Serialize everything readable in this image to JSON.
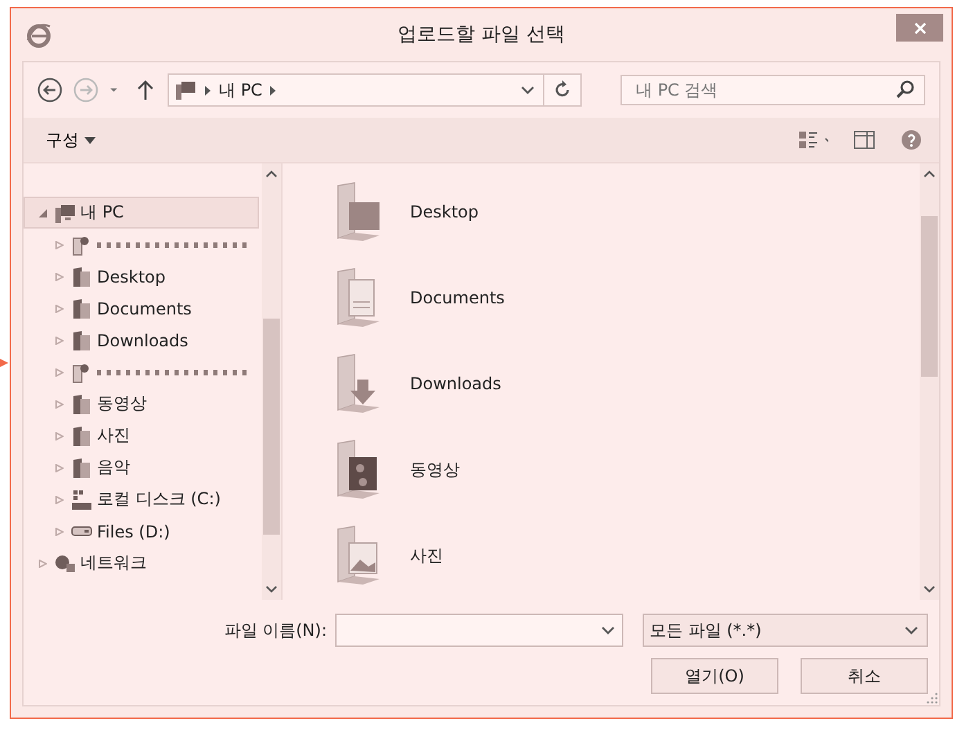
{
  "window": {
    "title": "업로드할 파일 선택"
  },
  "address_bar": {
    "path": [
      "내 PC"
    ]
  },
  "search": {
    "placeholder": "내 PC 검색"
  },
  "toolbar": {
    "organize": "구성"
  },
  "tree": [
    {
      "label": "내 PC",
      "kind": "pc",
      "selected": true,
      "expanded": true,
      "children": [
        {
          "kind": "redacted-user",
          "selected": false
        },
        {
          "label": "Desktop",
          "kind": "desktop",
          "selected": false
        },
        {
          "label": "Documents",
          "kind": "documents",
          "selected": false
        },
        {
          "label": "Downloads",
          "kind": "downloads",
          "selected": false
        },
        {
          "kind": "redacted-user",
          "selected": false
        },
        {
          "label": "동영상",
          "kind": "videos",
          "selected": false
        },
        {
          "label": "사진",
          "kind": "pictures",
          "selected": false
        },
        {
          "label": "음악",
          "kind": "music",
          "selected": false
        },
        {
          "label": "로컬 디스크 (C:)",
          "kind": "disk",
          "selected": false
        },
        {
          "label": "Files (D:)",
          "kind": "drive",
          "selected": false
        }
      ]
    },
    {
      "label": "네트워크",
      "kind": "network",
      "selected": false,
      "expanded": false
    }
  ],
  "items": [
    {
      "label": "Desktop",
      "kind": "desktop"
    },
    {
      "label": "Documents",
      "kind": "documents"
    },
    {
      "label": "Downloads",
      "kind": "downloads"
    },
    {
      "label": "동영상",
      "kind": "videos"
    },
    {
      "label": "사진",
      "kind": "pictures"
    }
  ],
  "filename": {
    "label": "파일 이름(N):"
  },
  "filter": {
    "value": "모든 파일 (*.*)"
  },
  "buttons": [
    "열기(O)",
    "취소"
  ]
}
